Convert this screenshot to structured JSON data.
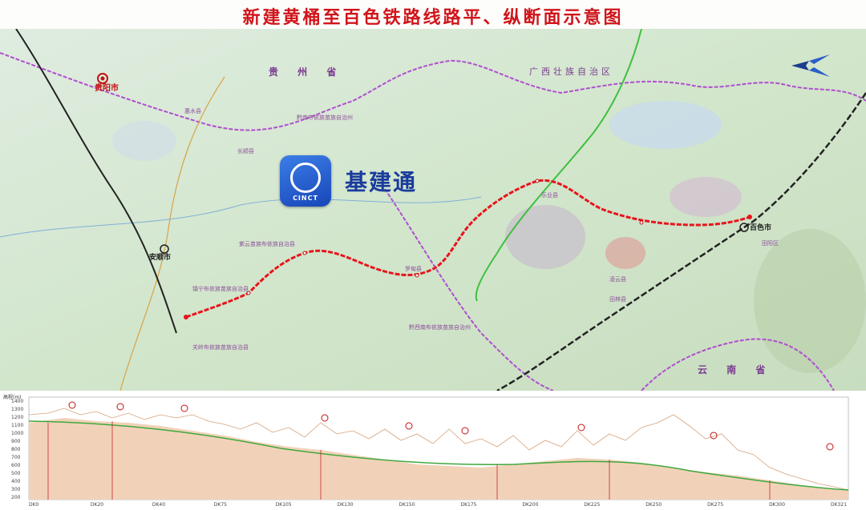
{
  "title": "新建黄桶至百色铁路线路平、纵断面示意图",
  "map": {
    "provinces": {
      "guizhou": "贵 州 省",
      "guangxi": "广西壮族自治区",
      "yunnan": "云 南 省"
    },
    "prefectures": {
      "qiannan": "黔南布依族苗族自治州",
      "qianxinan": "黔西南布依族苗族自治州"
    },
    "cities": {
      "guiyang": "贵阳市",
      "anshun": "安顺市",
      "baise": "百色市"
    },
    "county_labels": {
      "ziyun": "紫云苗族布依族自治县",
      "zhenning": "镇宁布依族苗族自治县",
      "guanling": "关岭布依族苗族自治县",
      "luodian": "罗甸县",
      "leye": "乐业县",
      "lingyun": "凌云县",
      "tianyang": "田阳区",
      "tianlin": "田林县",
      "changshun": "长顺县",
      "huishui": "惠水县"
    },
    "watermark": {
      "logo_text": "CINCT",
      "name": "基建通"
    },
    "colors": {
      "route": "#e8141c",
      "border": "#b04ed0",
      "existing_rail": "#222222",
      "green_route": "#3fbf3f",
      "map_base": "#d9ead2"
    }
  },
  "profile": {
    "axis_header": "高程(m)",
    "elevations": [
      "1400",
      "1300",
      "1200",
      "1100",
      "1000",
      "900",
      "800",
      "700",
      "600",
      "500",
      "400",
      "300",
      "200"
    ],
    "mileage_ticks": [
      "DK0",
      "DK20",
      "DK40",
      "DK75",
      "DK105",
      "DK130",
      "DK150",
      "DK175",
      "DK200",
      "DK225",
      "DK250",
      "DK275",
      "DK300",
      "DK321"
    ]
  }
}
